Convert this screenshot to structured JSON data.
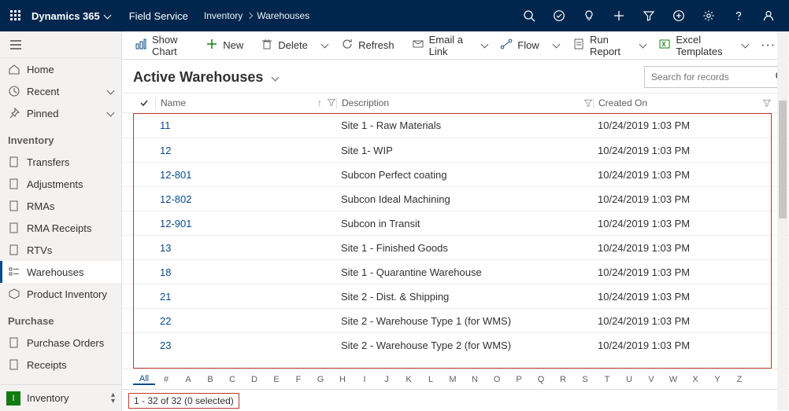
{
  "topbar": {
    "brand": "Dynamics 365",
    "module": "Field Service",
    "crumb_parent": "Inventory",
    "crumb_current": "Warehouses"
  },
  "sidebar": {
    "quick": {
      "home": "Home",
      "recent": "Recent",
      "pinned": "Pinned"
    },
    "group_inventory": "Inventory",
    "inventory_items": {
      "transfers": "Transfers",
      "adjustments": "Adjustments",
      "rmas": "RMAs",
      "rma_receipts": "RMA Receipts",
      "rtvs": "RTVs",
      "warehouses": "Warehouses",
      "product_inventory": "Product Inventory"
    },
    "group_purchase": "Purchase",
    "purchase_items": {
      "purchase_orders": "Purchase Orders",
      "receipts": "Receipts"
    },
    "footer_badge": "I",
    "footer_label": "Inventory"
  },
  "commands": {
    "show_chart": "Show Chart",
    "new": "New",
    "delete": "Delete",
    "refresh": "Refresh",
    "email": "Email a Link",
    "flow": "Flow",
    "run_report": "Run Report",
    "excel": "Excel Templates"
  },
  "view": {
    "title": "Active Warehouses"
  },
  "search": {
    "placeholder": "Search for records"
  },
  "columns": {
    "name": "Name",
    "description": "Description",
    "created_on": "Created On"
  },
  "rows": [
    {
      "name": "11",
      "desc": "Site 1 - Raw Materials",
      "created": "10/24/2019 1:03 PM"
    },
    {
      "name": "12",
      "desc": "Site 1- WIP",
      "created": "10/24/2019 1:03 PM"
    },
    {
      "name": "12-801",
      "desc": "Subcon Perfect coating",
      "created": "10/24/2019 1:03 PM"
    },
    {
      "name": "12-802",
      "desc": "Subcon Ideal Machining",
      "created": "10/24/2019 1:03 PM"
    },
    {
      "name": "12-901",
      "desc": "Subcon in Transit",
      "created": "10/24/2019 1:03 PM"
    },
    {
      "name": "13",
      "desc": "Site 1 - Finished Goods",
      "created": "10/24/2019 1:03 PM"
    },
    {
      "name": "18",
      "desc": "Site 1 - Quarantine Warehouse",
      "created": "10/24/2019 1:03 PM"
    },
    {
      "name": "21",
      "desc": "Site 2 - Dist. & Shipping",
      "created": "10/24/2019 1:03 PM"
    },
    {
      "name": "22",
      "desc": "Site 2 - Warehouse Type 1 (for WMS)",
      "created": "10/24/2019 1:03 PM"
    },
    {
      "name": "23",
      "desc": "Site 2 - Warehouse Type 2 (for WMS)",
      "created": "10/24/2019 1:03 PM"
    }
  ],
  "alphabar": [
    "All",
    "#",
    "A",
    "B",
    "C",
    "D",
    "E",
    "F",
    "G",
    "H",
    "I",
    "J",
    "K",
    "L",
    "M",
    "N",
    "O",
    "P",
    "Q",
    "R",
    "S",
    "T",
    "U",
    "V",
    "W",
    "X",
    "Y",
    "Z"
  ],
  "status": {
    "range": "1 - 32 of 32 (0 selected)"
  }
}
